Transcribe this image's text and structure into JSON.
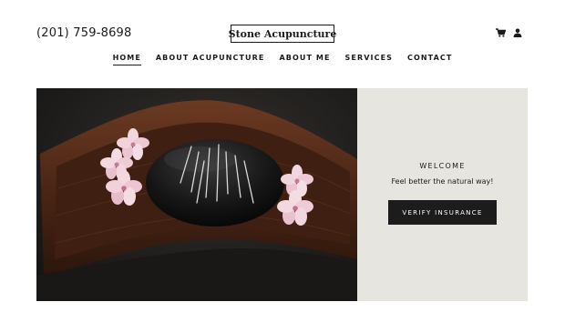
{
  "header": {
    "phone": "(201) 759-8698",
    "logo": "Stone Acupuncture",
    "icons": [
      "cart-icon",
      "user-icon"
    ]
  },
  "nav": {
    "items": [
      {
        "label": "HOME",
        "active": true
      },
      {
        "label": "ABOUT ACUPUNCTURE",
        "active": false
      },
      {
        "label": "ABOUT ME",
        "active": false
      },
      {
        "label": "SERVICES",
        "active": false
      },
      {
        "label": "CONTACT",
        "active": false
      }
    ]
  },
  "hero": {
    "welcome": "WELCOME",
    "tagline": "Feel better the natural way!",
    "cta_label": "VERIFY INSURANCE"
  },
  "colors": {
    "panel_bg": "#e7e5e0",
    "button_bg": "#1c1c1c",
    "text": "#1b1b1b"
  }
}
